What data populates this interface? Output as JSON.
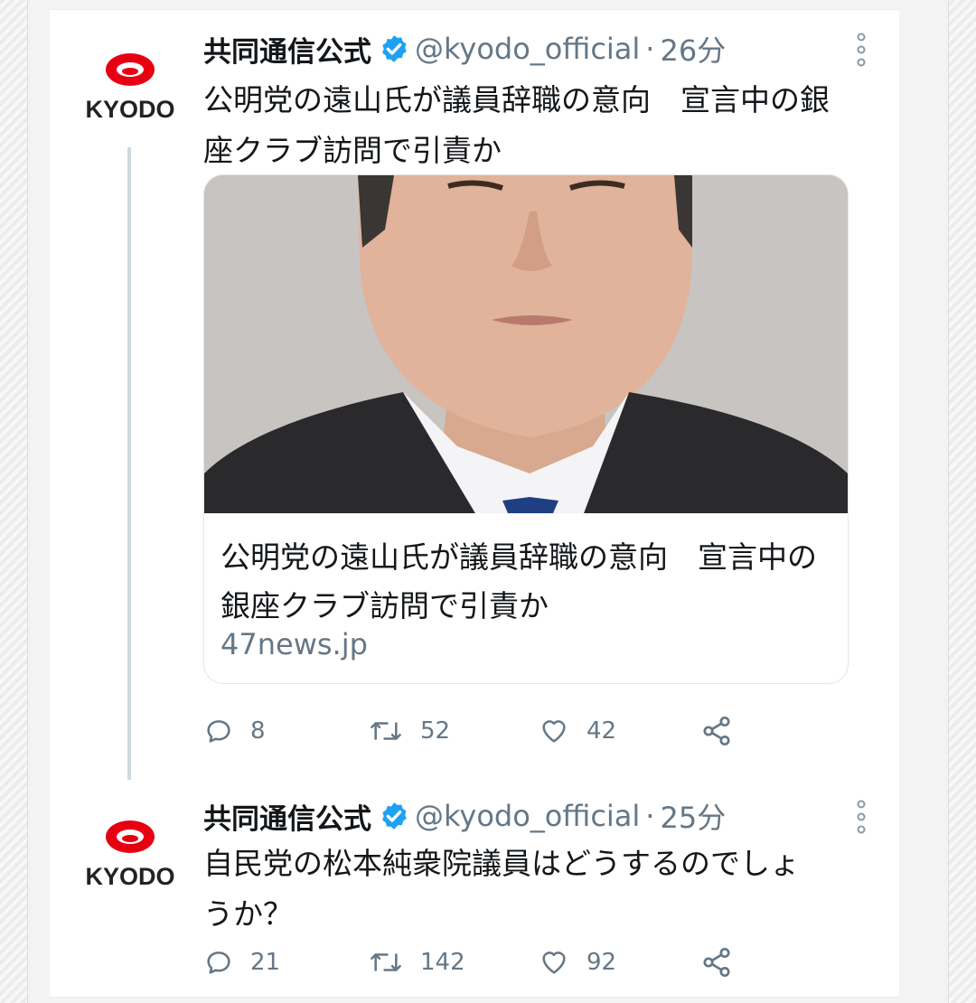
{
  "tweets": [
    {
      "author_name": "共同通信公式",
      "handle": "@kyodo_official",
      "separator": "·",
      "time": "26分",
      "avatar_text": "KYODO",
      "text": "公明党の遠山氏が議員辞職の意向　宣言中の銀座クラブ訪問で引責か",
      "link_card": {
        "title": "公明党の遠山氏が議員辞職の意向　宣言中の銀座クラブ訪問で引責か",
        "domain": "47news.jp"
      },
      "replies": "8",
      "retweets": "52",
      "likes": "42"
    },
    {
      "author_name": "共同通信公式",
      "handle": "@kyodo_official",
      "separator": "·",
      "time": "25分",
      "avatar_text": "KYODO",
      "text": "自民党の松本純衆院議員はどうするのでしょうか？",
      "replies": "21",
      "retweets": "142",
      "likes": "92"
    }
  ],
  "icons": {
    "reply": "reply-icon",
    "retweet": "retweet-icon",
    "like": "heart-icon",
    "share": "share-icon",
    "verified": "verified-badge-icon",
    "more": "more-vertical-icon"
  },
  "colors": {
    "verified": "#1da1f2",
    "secondary_text": "#657786",
    "primary_text": "#14171a",
    "kyodo_red": "#e60012"
  }
}
